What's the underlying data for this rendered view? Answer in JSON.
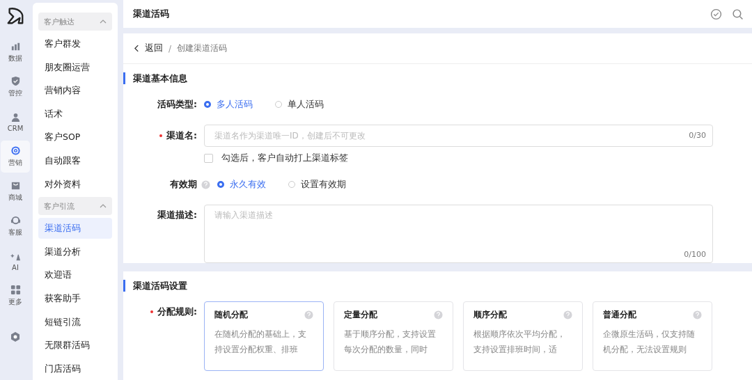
{
  "rail": [
    {
      "label": "数据",
      "kind": "chart",
      "selected": false
    },
    {
      "label": "管控",
      "kind": "shield",
      "selected": false
    },
    {
      "label": "CRM",
      "kind": "person",
      "selected": false
    },
    {
      "label": "营销",
      "kind": "target",
      "selected": true
    },
    {
      "label": "商城",
      "kind": "bag",
      "selected": false
    },
    {
      "label": "客服",
      "kind": "headset",
      "selected": false
    },
    {
      "label": "AI",
      "kind": "ai",
      "selected": false
    },
    {
      "label": "更多",
      "kind": "grid",
      "selected": false
    }
  ],
  "sidebar": {
    "groups": [
      {
        "title": "客户触达",
        "expanded": true,
        "items": [
          {
            "label": "客户群发",
            "selected": false
          },
          {
            "label": "朋友圈运营",
            "selected": false
          },
          {
            "label": "营销内容",
            "selected": false
          },
          {
            "label": "话术",
            "selected": false
          },
          {
            "label": "客户SOP",
            "selected": false
          },
          {
            "label": "自动跟客",
            "selected": false
          },
          {
            "label": "对外资料",
            "selected": false
          }
        ]
      },
      {
        "title": "客户引流",
        "expanded": true,
        "items": [
          {
            "label": "渠道活码",
            "selected": true
          },
          {
            "label": "渠道分析",
            "selected": false
          },
          {
            "label": "欢迎语",
            "selected": false
          },
          {
            "label": "获客助手",
            "selected": false
          },
          {
            "label": "短链引流",
            "selected": false
          },
          {
            "label": "无限群活码",
            "selected": false
          },
          {
            "label": "门店活码",
            "selected": false
          }
        ]
      }
    ]
  },
  "header": {
    "title": "渠道活码"
  },
  "breadcrumb": {
    "back": "返回",
    "separator": "/",
    "current": "创建渠道活码"
  },
  "basic": {
    "title": "渠道基本信息",
    "code_type": {
      "label": "活码类型:",
      "options": [
        {
          "label": "多人活码",
          "selected": true
        },
        {
          "label": "单人活码",
          "selected": false
        }
      ]
    },
    "name": {
      "label": "渠道名:",
      "required": true,
      "placeholder": "渠道名作为渠道唯一ID，创建后不可更改",
      "count": "0/30",
      "tag_option": {
        "label": "勾选后，客户自动打上渠道标签",
        "checked": false
      }
    },
    "validity": {
      "label": "有效期",
      "options": [
        {
          "label": "永久有效",
          "selected": true
        },
        {
          "label": "设置有效期",
          "selected": false
        }
      ]
    },
    "description": {
      "label": "渠道描述:",
      "placeholder": "请输入渠道描述",
      "count": "0/100"
    }
  },
  "settings": {
    "title": "渠道活码设置",
    "rule": {
      "label": "分配规则:",
      "required": true,
      "options": [
        {
          "title": "随机分配",
          "description": "在随机分配的基础上，支持设置分配权重、排班",
          "selected": true
        },
        {
          "title": "定量分配",
          "description": "基于顺序分配，支持设置每次分配的数量，同时",
          "selected": false
        },
        {
          "title": "顺序分配",
          "description": "根据顺序依次平均分配，支持设置排班时间，适",
          "selected": false
        },
        {
          "title": "普通分配",
          "description": "企微原生活码，仅支持随机分配，无法设置规则",
          "selected": false
        }
      ]
    }
  }
}
